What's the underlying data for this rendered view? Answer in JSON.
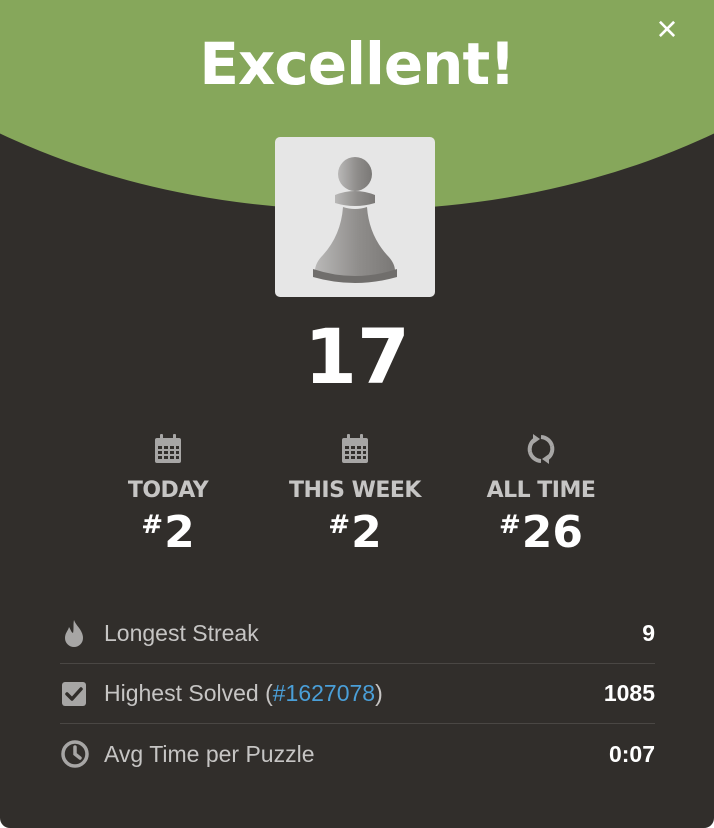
{
  "modal": {
    "title": "Excellent!",
    "close_label": "×",
    "piece_icon": "pawn-icon",
    "score": "17"
  },
  "ranks": [
    {
      "icon": "calendar-icon",
      "label": "TODAY",
      "hash": "#",
      "value": "2"
    },
    {
      "icon": "calendar-icon",
      "label": "THIS WEEK",
      "hash": "#",
      "value": "2"
    },
    {
      "icon": "refresh-icon",
      "label": "ALL TIME",
      "hash": "#",
      "value": "26"
    }
  ],
  "stats": [
    {
      "icon": "flame-icon",
      "label": "Longest Streak",
      "value": "9"
    },
    {
      "icon": "checkbox-icon",
      "label_prefix": "Highest Solved (",
      "link": "#1627078",
      "label_suffix": ")",
      "value": "1085"
    },
    {
      "icon": "clock-icon",
      "label": "Avg Time per Puzzle",
      "value": "0:07"
    }
  ],
  "colors": {
    "header_green": "#86a75b",
    "background": "#312e2b",
    "link_blue": "#4a9fd8"
  }
}
